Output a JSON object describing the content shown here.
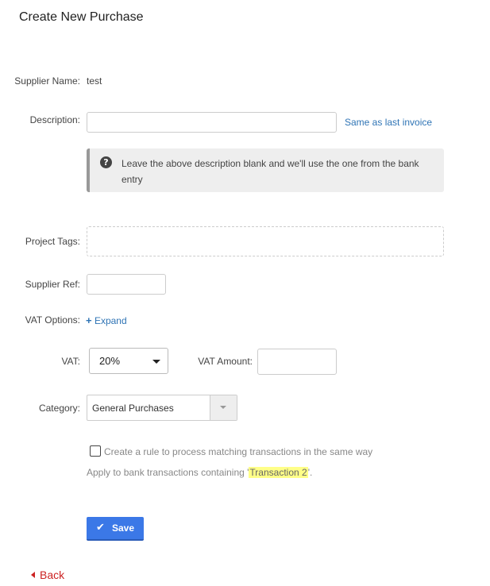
{
  "page": {
    "title": "Create New Purchase"
  },
  "supplier": {
    "label": "Supplier Name:",
    "value": "test"
  },
  "description": {
    "label": "Description:",
    "value": "",
    "placeholder": "",
    "same_as_last_link": "Same as last invoice",
    "info_icon": "question-circle-icon",
    "info_text": "Leave the above description blank and we'll use the one from the bank entry"
  },
  "project_tags": {
    "label": "Project Tags:"
  },
  "supplier_ref": {
    "label": "Supplier Ref:",
    "value": ""
  },
  "vat_options": {
    "label": "VAT Options:",
    "expand_icon": "plus-icon",
    "expand_label": "Expand"
  },
  "vat": {
    "label": "VAT:",
    "selected": "20%",
    "amount_label": "VAT Amount:",
    "amount_value": ""
  },
  "category": {
    "label": "Category:",
    "selected": "General Purchases"
  },
  "rule": {
    "checkbox_label": "Create a rule to process matching transactions in the same way",
    "checked": false,
    "apply_prefix": "Apply to bank transactions containing '",
    "apply_term": "Transaction 2",
    "apply_suffix": "'."
  },
  "actions": {
    "save_icon": "check-icon",
    "save_label": "Save",
    "back_icon": "caret-left-icon",
    "back_label": "Back"
  },
  "colors": {
    "link": "#2f74b5",
    "primary_button": "#3b78e7",
    "back_link": "#cc2222",
    "highlight": "#ffff88",
    "info_bg": "#eeeeee"
  }
}
